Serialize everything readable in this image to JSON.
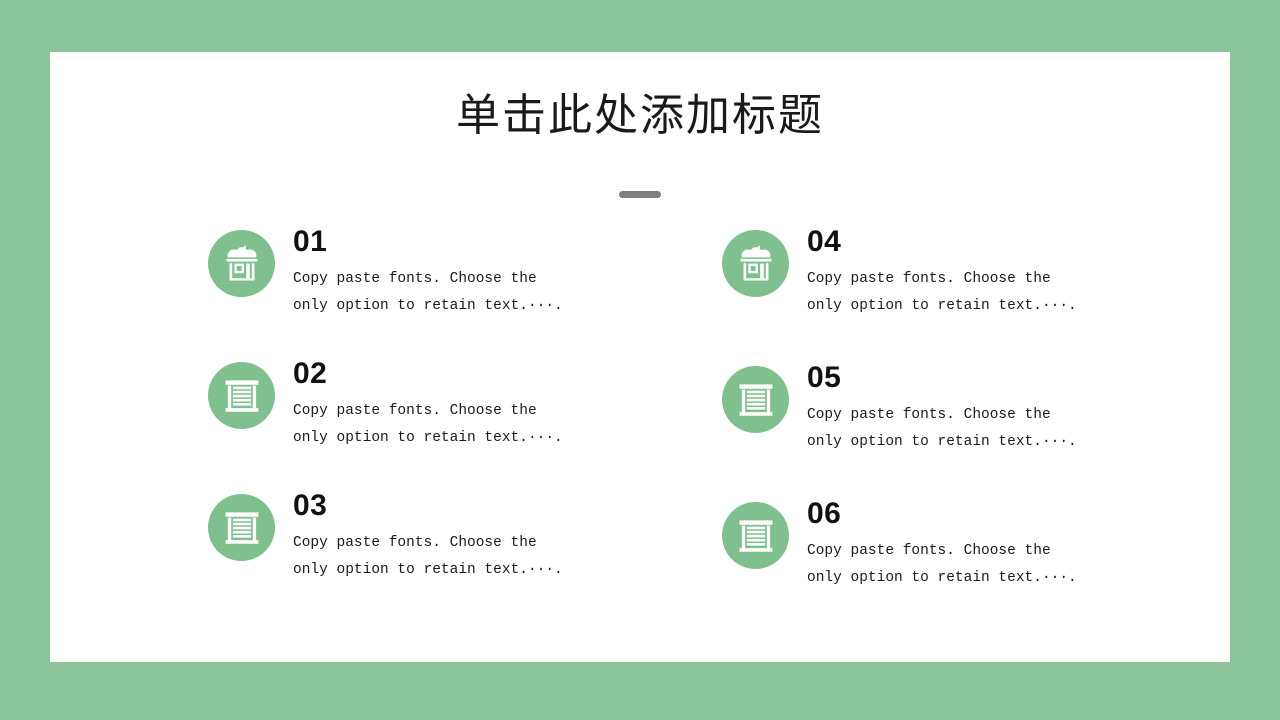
{
  "slide": {
    "background_color": "#8bc49a",
    "card_color": "#ffffff",
    "accent_color": "#7fc08e",
    "divider_color": "#7f7f7f",
    "title": "单击此处添加标题"
  },
  "items": [
    {
      "number": "01",
      "icon": "storefront-awning-check-icon",
      "description": "Copy paste fonts. Choose the\nonly option to retain text.···."
    },
    {
      "number": "02",
      "icon": "rolling-shutter-storefront-icon",
      "description": "Copy paste fonts. Choose the\nonly option to retain text.···."
    },
    {
      "number": "03",
      "icon": "rolling-shutter-storefront-icon",
      "description": "Copy paste fonts. Choose the\nonly option to retain text.···."
    },
    {
      "number": "04",
      "icon": "storefront-awning-check-icon",
      "description": "Copy paste fonts. Choose the\nonly option to retain text.···."
    },
    {
      "number": "05",
      "icon": "rolling-shutter-storefront-icon",
      "description": "Copy paste fonts. Choose the\nonly option to retain text.···."
    },
    {
      "number": "06",
      "icon": "rolling-shutter-storefront-icon",
      "description": "Copy paste fonts. Choose the\nonly option to retain text.···."
    }
  ]
}
